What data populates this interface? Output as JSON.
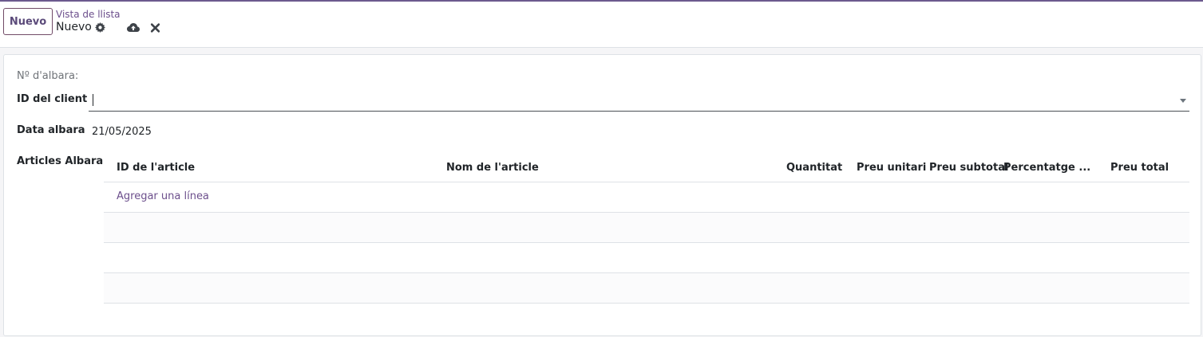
{
  "control_panel": {
    "new_button_label": "Nuevo",
    "breadcrumb": "Vista de llista",
    "record_title": "Nuevo"
  },
  "form": {
    "albara_number_label": "Nº d'albara:",
    "client_label": "ID del client",
    "client_value": "",
    "date_label": "Data albara",
    "date_value": "21/05/2025",
    "articles_label": "Articles Albara"
  },
  "lines": {
    "columns": [
      "ID de l'article",
      "Nom de l'article",
      "Quantitat",
      "Preu unitari",
      "Preu subtotal",
      "Percentatge ...",
      "Preu total"
    ],
    "add_line_label": "Agregar una línea"
  },
  "colors": {
    "accent": "#714b67",
    "link": "#6c4f8c"
  }
}
